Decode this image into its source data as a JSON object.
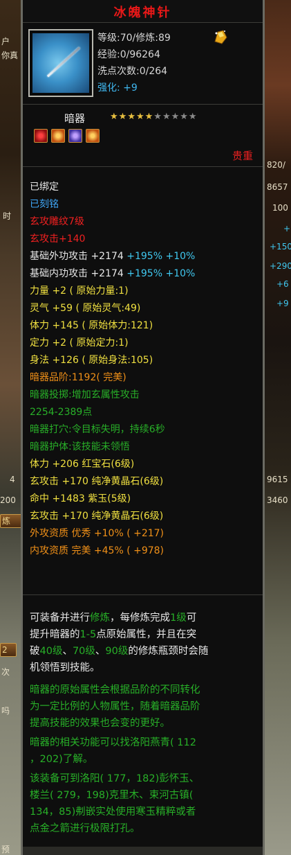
{
  "background": {
    "left_texts": [
      "户",
      "你真",
      "时",
      "次",
      "吗",
      "预"
    ],
    "left_buttons": [
      "炼",
      "2"
    ],
    "right_texts": [
      "820/",
      "8657",
      "100",
      "+",
      "+150",
      "+290",
      "+6",
      "+9",
      "9615",
      "3460"
    ],
    "left_numbers": [
      "4",
      "200"
    ]
  },
  "item": {
    "name": "冰魄神针",
    "level_line": "等级:70/修炼:89",
    "exp_line": "经验:0/96264",
    "wash_line": "洗点次数:0/264",
    "strengthen_label": "强化:",
    "strengthen_value": "+9",
    "type": "暗器",
    "stars_filled": 5,
    "stars_total": 10,
    "rarity": "贵重",
    "slot_icons": [
      "red-gem-icon",
      "orange-gem-icon",
      "purple-gem-icon",
      "orange-gem-icon"
    ]
  },
  "attributes": [
    {
      "text": "已绑定",
      "color": "white"
    },
    {
      "text": "已刻铭",
      "color": "blue"
    },
    {
      "text": "玄攻雕纹7级",
      "color": "red"
    },
    {
      "text": "玄攻击+140",
      "color": "red"
    },
    {
      "text": "基础外功攻击 +2174 ",
      "extra": "+195% +10%",
      "color": "white"
    },
    {
      "text": "基础内功攻击 +2174 ",
      "extra": "+195% +10%",
      "color": "white"
    },
    {
      "text": "力量 +2 ( 原始力量:1)",
      "color": "yellow"
    },
    {
      "text": "灵气 +59 ( 原始灵气:49)",
      "color": "yellow"
    },
    {
      "text": "体力 +145 ( 原始体力:121)",
      "color": "yellow"
    },
    {
      "text": "定力 +2 ( 原始定力:1)",
      "color": "yellow"
    },
    {
      "text": "身法 +126 ( 原始身法:105)",
      "color": "yellow"
    },
    {
      "text": "暗器品阶:1192( 完美)",
      "color": "orange"
    },
    {
      "text": "暗器投掷:增加玄属性攻击",
      "color": "green"
    },
    {
      "text": "2254-2389点",
      "color": "green"
    },
    {
      "text": "暗器打穴:令目标失明，持续6秒",
      "color": "green"
    },
    {
      "text": "暗器护体:该技能未领悟",
      "color": "green"
    },
    {
      "text": "体力 +206 红宝石(6级)",
      "color": "yellow"
    },
    {
      "text": "玄攻击 +170 纯净黄晶石(6级)",
      "color": "yellow"
    },
    {
      "text": "命中 +1483 紫玉(5级)",
      "color": "yellow"
    },
    {
      "text": "玄攻击 +170 纯净黄晶石(6级)",
      "color": "yellow"
    },
    {
      "text": "外攻资质  优秀 +10% ( +217)",
      "color": "orange"
    },
    {
      "text": "内攻资质  完美 +45% ( +978)",
      "color": "orange"
    }
  ],
  "description": {
    "l1_a": "可装备并进行",
    "l1_b": "修炼",
    "l1_c": "，每修炼完成",
    "l1_d": "1级",
    "l1_e": "可",
    "l2_a": "提升暗器的",
    "l2_b": "1-5",
    "l2_c": "点原始属性，并且在突",
    "l3_a": "破",
    "l3_b": "40级",
    "l3_c": "、",
    "l3_d": "70级",
    "l3_e": "、",
    "l3_f": "90级",
    "l3_g": "的修炼瓶颈时会随",
    "l4": "机领悟到技能。",
    "l5": "暗器的原始属性会根据品阶的不同转化",
    "l6": "为一定比例的人物属性，随着暗器品阶",
    "l7": "提高技能的效果也会变的更好。",
    "l8": "暗器的相关功能可以找洛阳燕青( 112",
    "l9": "，202)了解。",
    "l10": "该装备可到洛阳( 177，182)彭怀玉、",
    "l11": "楼兰( 279，198)克里木、束河古镇(",
    "l12": "134，85)刜嵌实处使用寒玉精粹或者",
    "l13": "点金之箭进行极限打孔。"
  },
  "colors": {
    "title": "#e81818",
    "white": "#e8e8e8",
    "blue": "#40a8f8",
    "red": "#f02020",
    "yellow": "#f0e040",
    "orange": "#f09018",
    "green": "#28b028",
    "cyan": "#40c8f0"
  }
}
